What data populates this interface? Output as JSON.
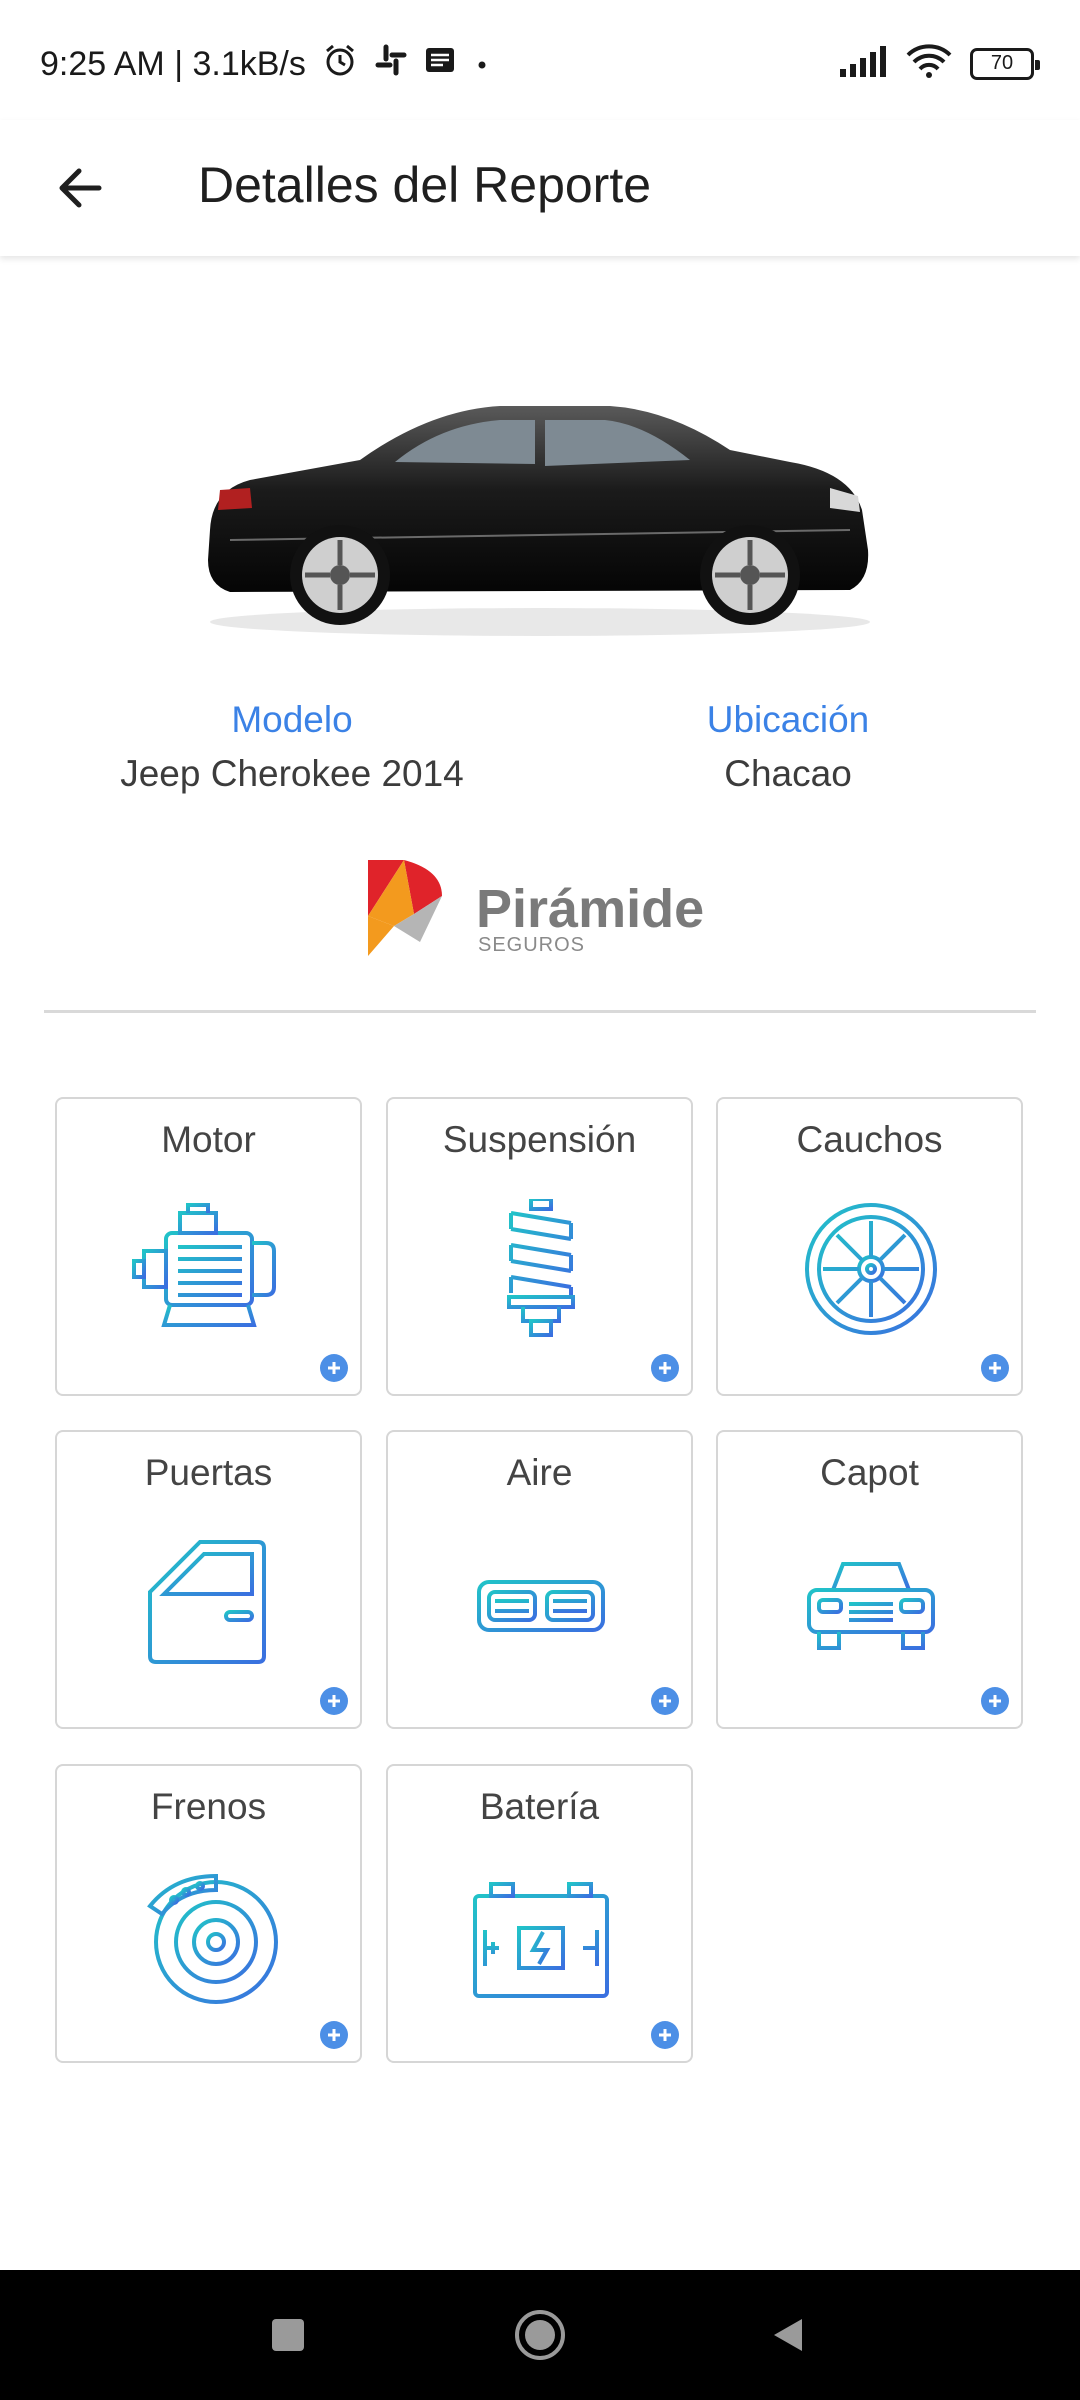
{
  "status_bar": {
    "time_speed": "9:25 AM | 3.1kB/s",
    "battery_level": "70",
    "icons": [
      "alarm-icon",
      "slack-icon",
      "news-icon",
      "dot-icon",
      "signal-icon",
      "wifi-icon",
      "battery-icon"
    ]
  },
  "app_bar": {
    "title": "Detalles del Reporte",
    "back_icon": "arrow-left-icon"
  },
  "vehicle": {
    "model_label": "Modelo",
    "model_value": "Jeep Cherokee 2014",
    "location_label": "Ubicación",
    "location_value": "Chacao"
  },
  "insurer": {
    "name": "Pirámide",
    "sub": "SEGUROS"
  },
  "categories": [
    {
      "label": "Motor",
      "icon": "engine-icon"
    },
    {
      "label": "Suspensión",
      "icon": "spring-icon"
    },
    {
      "label": "Cauchos",
      "icon": "wheel-icon"
    },
    {
      "label": "Puertas",
      "icon": "car-door-icon"
    },
    {
      "label": "Aire",
      "icon": "air-vent-icon"
    },
    {
      "label": "Capot",
      "icon": "car-front-icon"
    },
    {
      "label": "Frenos",
      "icon": "brake-disc-icon"
    },
    {
      "label": "Batería",
      "icon": "battery-car-icon"
    }
  ],
  "colors": {
    "accent": "#3b82e6",
    "icon_teal": "#1fb5c9",
    "icon_blue": "#3b7de0",
    "plus": "#4c8fe6"
  },
  "nav_bar": {
    "icons": [
      "recents-square-icon",
      "home-circle-icon",
      "back-triangle-icon"
    ]
  }
}
